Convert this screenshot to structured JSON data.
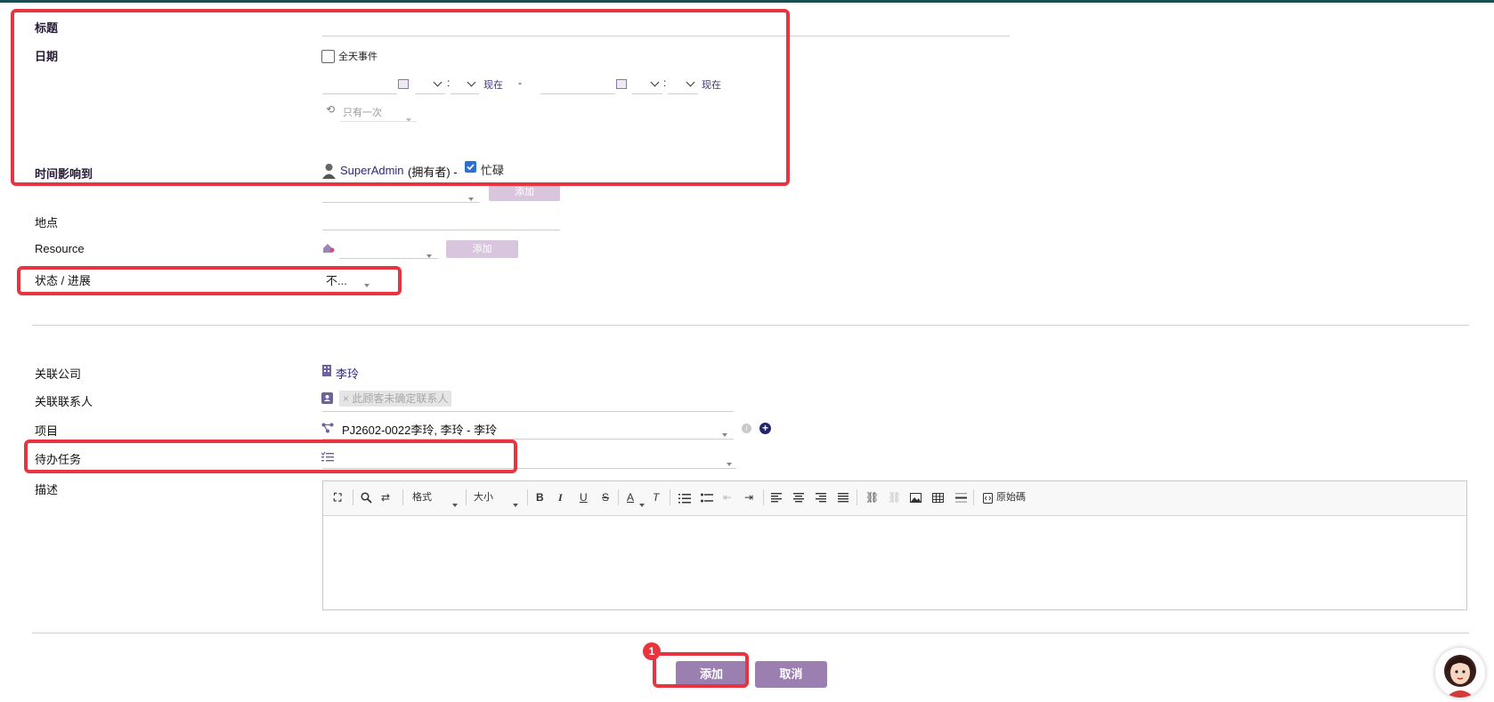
{
  "form": {
    "title_label": "标题",
    "date_label": "日期",
    "allday_label": "全天事件",
    "now_label": "现在",
    "range_separator": "-",
    "time_colon": ":",
    "repeat_value": "只有一次",
    "affects_label": "时间影响到",
    "owner_name": "SuperAdmin",
    "owner_role": "(拥有者) -",
    "busy_label": "忙碌",
    "add_label": "添加",
    "location_label": "地点",
    "resource_label": "Resource",
    "status_label": "状态 / 进展",
    "status_value": "不...",
    "company_label": "关联公司",
    "company_value": "李玲",
    "contact_label": "关联联系人",
    "contact_chip": "× 此顾客未确定联系人",
    "project_label": "项目",
    "project_value": "PJ2602-0022李玲, 李玲 - 李玲",
    "task_label": "待办任务",
    "desc_label": "描述"
  },
  "toolbar": {
    "format_label": "格式",
    "size_label": "大小",
    "bold": "B",
    "italic": "I",
    "underline": "U",
    "strike": "S",
    "fontcolor": "A",
    "removeformat": "T",
    "source_label": "原始碼"
  },
  "actions": {
    "add_label": "添加",
    "cancel_label": "取消",
    "badge": "1"
  },
  "colors": {
    "accent": "#9c7fb1",
    "highlight": "#e8343f",
    "link": "#3b3477"
  }
}
